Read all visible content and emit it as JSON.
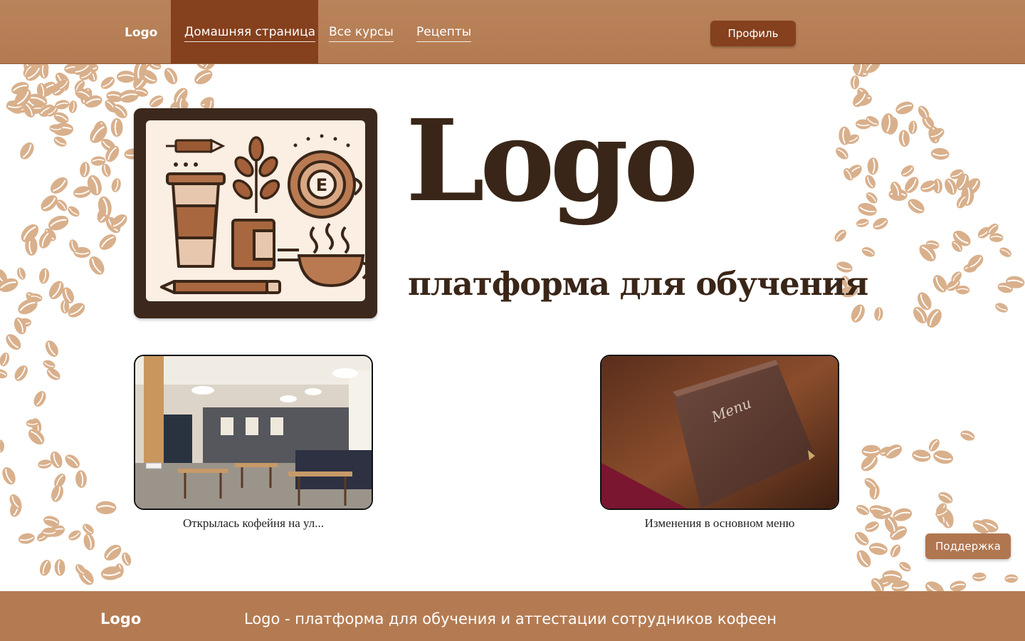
{
  "header": {
    "logo_text": "Logo",
    "nav": {
      "home": "Домашняя страница",
      "courses": "Все курсы",
      "recipes": "Рецепты"
    },
    "profile_button": "Профиль"
  },
  "hero": {
    "logo_image_alt": "coffee-themed-logo-illustration",
    "title": "Logo",
    "subtitle": "платформа для обучения"
  },
  "news": [
    {
      "image_alt": "cafe-interior-photo",
      "caption": "Открылась кофейня на ул..."
    },
    {
      "image_alt": "leather-menu-photo",
      "caption": "Изменения в основном меню",
      "image_text": "Menu"
    }
  ],
  "support_button": "Поддержка",
  "footer": {
    "logo_text": "Logo",
    "tagline": "Logo - платформа для обучения и аттестации сотрудников кофеен"
  },
  "colors": {
    "header_bg": "#b47b52",
    "nav_active_bg": "#85401d",
    "brand_dark": "#3a2618",
    "bean": "#d9b08c"
  }
}
